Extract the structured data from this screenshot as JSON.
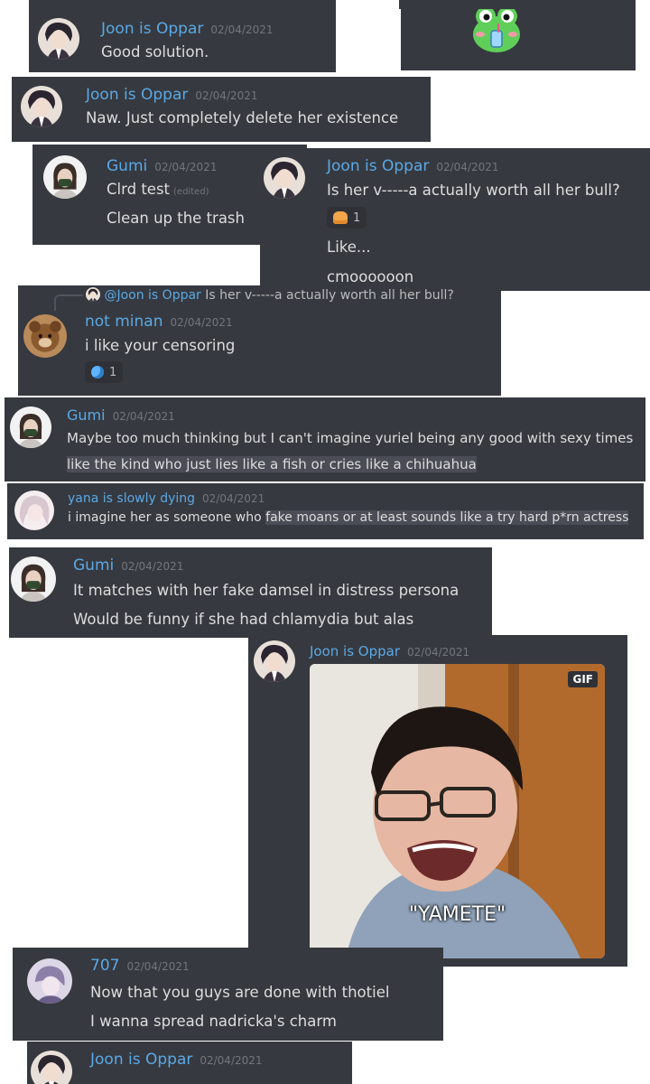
{
  "colors": {
    "joon": "#5aa9e6",
    "gumi": "#5aa9e6",
    "minan": "#5aa9e6",
    "yana": "#5aa9e6",
    "u707": "#5aa9e6",
    "card": "#36393f",
    "timestamp": "#72767d"
  },
  "messages": {
    "m1": {
      "author": "Joon is Oppar",
      "time": "02/04/2021",
      "text": "Good solution."
    },
    "m2": {
      "author": "Joon is Oppar",
      "time": "02/04/2021",
      "text": "Naw. Just completely delete her existence"
    },
    "m3": {
      "author": "Gumi",
      "time": "02/04/2021",
      "line1": "Clrd test",
      "edited": "(edited)",
      "line2": "Clean up the trash"
    },
    "m4": {
      "author": "Joon is Oppar",
      "time": "02/04/2021",
      "line1": "Is her v-----a actually worth all her bull?",
      "reaction_count": "1",
      "line2": "Like...",
      "line3": "cmoooooon"
    },
    "m5": {
      "reply_author": "@Joon is Oppar",
      "reply_text": "Is her v-----a actually worth all her bull?",
      "author": "not minan",
      "time": "02/04/2021",
      "text": "i like your censoring",
      "reaction_count": "1"
    },
    "m6": {
      "author": "Gumi",
      "time": "02/04/2021",
      "line1": "Maybe too much thinking but I can't imagine yuriel being any good with sexy times",
      "line2": "like the kind who just lies like a fish or cries like a chihuahua"
    },
    "m7": {
      "author": "yana is slowly dying",
      "time": "02/04/2021",
      "text_a": "i imagine her as someone who ",
      "text_b": "fake moans or at least sounds like a try hard p*rn actress"
    },
    "m8": {
      "author": "Gumi",
      "time": "02/04/2021",
      "line1": "It matches with her fake damsel in distress persona",
      "line2": "Would be funny if she had chlamydia but alas"
    },
    "m9": {
      "author": "Joon is Oppar",
      "time": "02/04/2021",
      "gif_badge": "GIF",
      "gif_caption": "\"YAMETE\""
    },
    "m10": {
      "author": "707",
      "time": "02/04/2021",
      "line1": "Now that you guys are done with thotiel",
      "line2": "I wanna spread nadricka's charm"
    },
    "m11": {
      "author": "Joon is Oppar",
      "time": "02/04/2021"
    }
  },
  "icons": {
    "reaction_m4": "bread-emoji-icon",
    "reaction_m5": "moon-emoji-icon",
    "sticker": "frog-sticker-icon"
  }
}
